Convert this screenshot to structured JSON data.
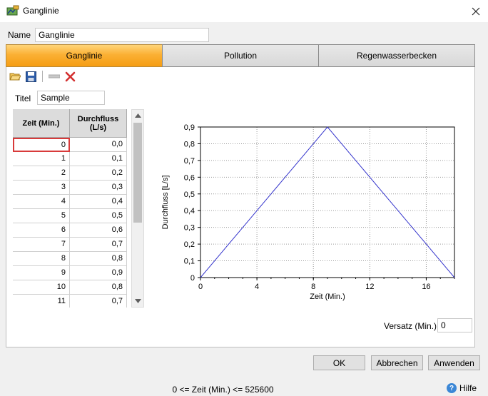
{
  "window": {
    "title": "Ganglinie"
  },
  "name_field": {
    "label": "Name",
    "value": "Ganglinie"
  },
  "tabs": [
    {
      "label": "Ganglinie",
      "active": true
    },
    {
      "label": "Pollution",
      "active": false
    },
    {
      "label": "Regenwasserbecken",
      "active": false
    }
  ],
  "toolbar": {
    "icons": [
      "open-folder-icon",
      "save-icon",
      "remove-row-icon",
      "delete-icon"
    ]
  },
  "titel_field": {
    "label": "Titel",
    "value": "Sample"
  },
  "table": {
    "headers": [
      "Zeit (Min.)",
      "Durchfluss\n(L/s)"
    ],
    "rows": [
      [
        "0",
        "0,0"
      ],
      [
        "1",
        "0,1"
      ],
      [
        "2",
        "0,2"
      ],
      [
        "3",
        "0,3"
      ],
      [
        "4",
        "0,4"
      ],
      [
        "5",
        "0,5"
      ],
      [
        "6",
        "0,6"
      ],
      [
        "7",
        "0,7"
      ],
      [
        "8",
        "0,8"
      ],
      [
        "9",
        "0,9"
      ],
      [
        "10",
        "0,8"
      ],
      [
        "11",
        "0,7"
      ]
    ]
  },
  "chart_data": {
    "type": "line",
    "xlabel": "Zeit (Min.)",
    "ylabel": "Durchfluss [L/s]",
    "xlim": [
      0,
      18
    ],
    "ylim": [
      0,
      0.9
    ],
    "xticks": [
      "0",
      "4",
      "8",
      "12",
      "16"
    ],
    "xtick_values": [
      0,
      4,
      8,
      12,
      16
    ],
    "yticks": [
      "0",
      "0,1",
      "0,2",
      "0,3",
      "0,4",
      "0,5",
      "0,6",
      "0,7",
      "0,8",
      "0,9"
    ],
    "ytick_values": [
      0,
      0.1,
      0.2,
      0.3,
      0.4,
      0.5,
      0.6,
      0.7,
      0.8,
      0.9
    ],
    "grid": true,
    "line_color": "#3333cc",
    "series": [
      {
        "x": [
          0,
          1,
          2,
          3,
          4,
          5,
          6,
          7,
          8,
          9,
          10,
          11,
          12,
          13,
          14,
          15,
          16,
          17,
          18
        ],
        "y": [
          0,
          0.1,
          0.2,
          0.3,
          0.4,
          0.5,
          0.6,
          0.7,
          0.8,
          0.9,
          0.8,
          0.7,
          0.6,
          0.5,
          0.4,
          0.3,
          0.2,
          0.1,
          0
        ]
      }
    ]
  },
  "versatz": {
    "label": "Versatz (Min.)",
    "value": "0"
  },
  "buttons": {
    "ok": "OK",
    "cancel": "Abbrechen",
    "apply": "Anwenden"
  },
  "status": {
    "text": "0 <= Zeit (Min.) <= 525600"
  },
  "help": {
    "label": "Hilfe"
  },
  "colors": {
    "active_tab": "#f7a41d",
    "selection_border": "#d83a3a",
    "plot_line": "#3333cc"
  }
}
